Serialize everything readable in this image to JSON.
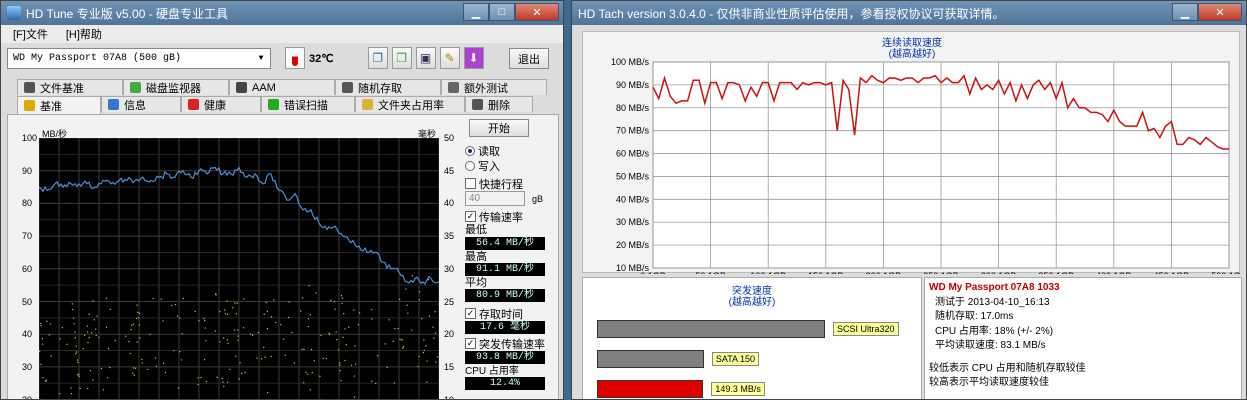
{
  "hdtune": {
    "title": "HD Tune 专业版 v5.00 - 硬盘专业工具",
    "menu": [
      "[F]文件",
      "[H]帮助"
    ],
    "drive": "WD     My Passport 07A8 (500 gB)",
    "temperature": "32℃",
    "exit_label": "退出",
    "tabs_top": [
      "文件基准",
      "磁盘监视器",
      "AAM",
      "随机存取",
      "额外测试"
    ],
    "tabs_bottom": [
      "基准",
      "信息",
      "健康",
      "错误扫描",
      "文件夹占用率",
      "删除"
    ],
    "y_unit_left": "MB/秒",
    "y_unit_right": "毫秒",
    "y_ticks_left": [
      "100",
      "90",
      "80",
      "70",
      "60",
      "50",
      "40",
      "30",
      "20"
    ],
    "y_ticks_right": [
      "50",
      "45",
      "40",
      "35",
      "30",
      "25",
      "20",
      "15",
      "10"
    ],
    "start_label": "开始",
    "read_label": "读取",
    "write_label": "写入",
    "quick_label": "快捷行程",
    "quick_value": "40",
    "quick_unit": "gB",
    "transfer_label": "传输速率",
    "min_label": "最低",
    "min_value": "56.4 MB/秒",
    "max_label": "最高",
    "max_value": "91.1 MB/秒",
    "avg_label": "平均",
    "avg_value": "80.9 MB/秒",
    "access_label": "存取时间",
    "access_value": "17.6 毫秒",
    "burst_label": "突发传输速率",
    "burst_value": "93.8 MB/秒",
    "cpu_label": "CPU 占用率",
    "cpu_value": "12.4%"
  },
  "hdtach": {
    "title": "HD Tach version 3.0.4.0 - 仅供非商业性质评估使用，参看授权协议可获取详情。",
    "chart_title_1": "连续读取速度",
    "chart_title_2": "(越高越好)",
    "burst_title_1": "突发速度",
    "burst_title_2": "(越高越好)",
    "bars": [
      {
        "label": "SCSI Ultra320",
        "value": 320,
        "color": "#808080"
      },
      {
        "label": "SATA 150",
        "value": 150,
        "color": "#808080"
      },
      {
        "label": "149.3 MB/s",
        "value": 149.3,
        "color": "#e00000"
      }
    ],
    "info": {
      "drive": "WD My Passport 07A8 1033",
      "date": "测试于 2013-04-10_16:13",
      "random": "随机存取: 17.0ms",
      "cpu": "CPU 占用率: 18% (+/- 2%)",
      "avg": "平均读取速度: 83.1 MB/s",
      "note1": "较低表示 CPU 占用和随机存取较佳",
      "note2": "较高表示平均读取速度较佳"
    }
  },
  "chart_data": [
    {
      "type": "line",
      "title": "连续读取速度 (越高越好)",
      "x_ticks": [
        "0.1GB",
        "50.1GB",
        "100.1GB",
        "150.1GB",
        "200.1GB",
        "250.1GB",
        "300.1GB",
        "350.1GB",
        "400.1GB",
        "450.1GB",
        "500.1GB"
      ],
      "y_ticks": [
        "10 MB/s",
        "20 MB/s",
        "30 MB/s",
        "40 MB/s",
        "50 MB/s",
        "60 MB/s",
        "70 MB/s",
        "80 MB/s",
        "90 MB/s",
        "100 MB/s"
      ],
      "ylim": [
        10,
        100
      ],
      "xlim": [
        0.1,
        500.1
      ],
      "series": [
        {
          "color": "#cc1111",
          "x": [
            0,
            5,
            10,
            15,
            20,
            25,
            30,
            35,
            40,
            45,
            50,
            55,
            60,
            65,
            70,
            75,
            80,
            85,
            90,
            95,
            100,
            105,
            110,
            115,
            120,
            125,
            130,
            135,
            140,
            145,
            150,
            155,
            160,
            165,
            170,
            175,
            180,
            185,
            190,
            195,
            200,
            205,
            210,
            215,
            220,
            225,
            230,
            235,
            240,
            245,
            250,
            255,
            260,
            265,
            270,
            275,
            280,
            285,
            290,
            295,
            300,
            305,
            310,
            315,
            320,
            325,
            330,
            335,
            340,
            345,
            350,
            355,
            360,
            365,
            370,
            375,
            380,
            385,
            390,
            395,
            400,
            405,
            410,
            415,
            420,
            425,
            430,
            435,
            440,
            445,
            450,
            455,
            460,
            465,
            470,
            475,
            480,
            485,
            490,
            495,
            500
          ],
          "y": [
            89,
            84,
            93,
            85,
            82,
            83,
            83,
            92,
            92,
            82,
            91,
            91,
            84,
            91,
            91,
            90,
            83,
            89,
            85,
            91,
            91,
            83,
            91,
            91,
            91,
            88,
            91,
            90,
            91,
            91,
            90,
            91,
            70,
            92,
            88,
            68,
            93,
            91,
            94,
            92,
            91,
            93,
            93,
            92,
            93,
            93,
            91,
            93,
            93,
            94,
            91,
            93,
            91,
            91,
            94,
            86,
            93,
            88,
            90,
            88,
            92,
            86,
            91,
            83,
            90,
            84,
            90,
            92,
            88,
            91,
            84,
            91,
            80,
            84,
            80,
            80,
            78,
            78,
            77,
            74,
            79,
            74,
            72,
            72,
            72,
            78,
            70,
            71,
            67,
            72,
            74,
            64,
            64,
            67,
            66,
            64,
            67,
            65,
            63,
            62,
            62
          ]
        }
      ]
    },
    {
      "type": "line",
      "title": "",
      "ylim": [
        20,
        100
      ],
      "xlim": [
        0,
        500
      ],
      "series": [
        {
          "name": "传输速率",
          "color": "#4c8fd6",
          "x": [
            0,
            10,
            20,
            30,
            40,
            50,
            60,
            70,
            80,
            90,
            100,
            110,
            120,
            130,
            140,
            150,
            160,
            170,
            180,
            190,
            200,
            210,
            220,
            230,
            240,
            250,
            260,
            270,
            280,
            290,
            300,
            310,
            320,
            330,
            340,
            350,
            360,
            370,
            380,
            390,
            400,
            410,
            420,
            430,
            440,
            450,
            460,
            470,
            480,
            490,
            500
          ],
          "y": [
            85,
            84,
            86,
            85,
            86,
            86,
            86,
            85,
            87,
            86,
            87,
            87,
            87,
            88,
            87,
            88,
            89,
            88,
            90,
            88,
            90,
            89,
            91,
            89,
            89,
            91,
            88,
            89,
            86,
            89,
            84,
            81,
            83,
            78,
            78,
            74,
            72,
            73,
            70,
            68,
            67,
            65,
            65,
            62,
            60,
            59,
            56,
            57,
            56,
            57,
            56
          ]
        },
        {
          "name": "存取时间",
          "color": "#d6d64a",
          "x": [],
          "y": []
        }
      ]
    }
  ]
}
